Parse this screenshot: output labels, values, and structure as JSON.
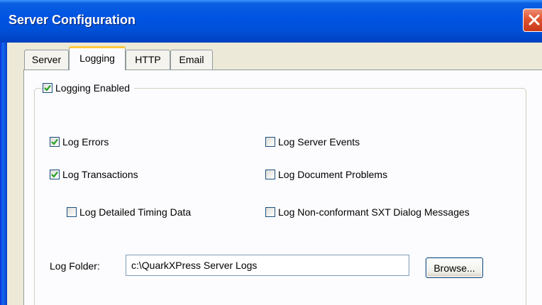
{
  "window": {
    "title": "Server Configuration",
    "close_icon": "close-icon"
  },
  "tabs": [
    {
      "label": "Server",
      "selected": false
    },
    {
      "label": "Logging",
      "selected": true
    },
    {
      "label": "HTTP",
      "selected": false
    },
    {
      "label": "Email",
      "selected": false
    }
  ],
  "logging": {
    "enabled": {
      "label": "Logging Enabled",
      "checked": true
    },
    "options": {
      "log_errors": {
        "label": "Log Errors",
        "checked": true
      },
      "log_transactions": {
        "label": "Log Transactions",
        "checked": true
      },
      "log_detailed_timing": {
        "label": "Log Detailed Timing Data",
        "checked": false
      },
      "log_server_events": {
        "label": "Log Server Events",
        "checked": false
      },
      "log_document_problems": {
        "label": "Log Document Problems",
        "checked": false
      },
      "log_sxt_messages": {
        "label": "Log Non-conformant SXT Dialog Messages",
        "checked": false
      }
    },
    "folder": {
      "label": "Log Folder:",
      "value": "c:\\QuarkXPress Server Logs",
      "browse_label": "Browse..."
    }
  },
  "colors": {
    "title_bar": "#0054E3",
    "check_mark": "#21A121",
    "active_tab_accent": "#FFC83C",
    "close_button": "#E0532F"
  }
}
